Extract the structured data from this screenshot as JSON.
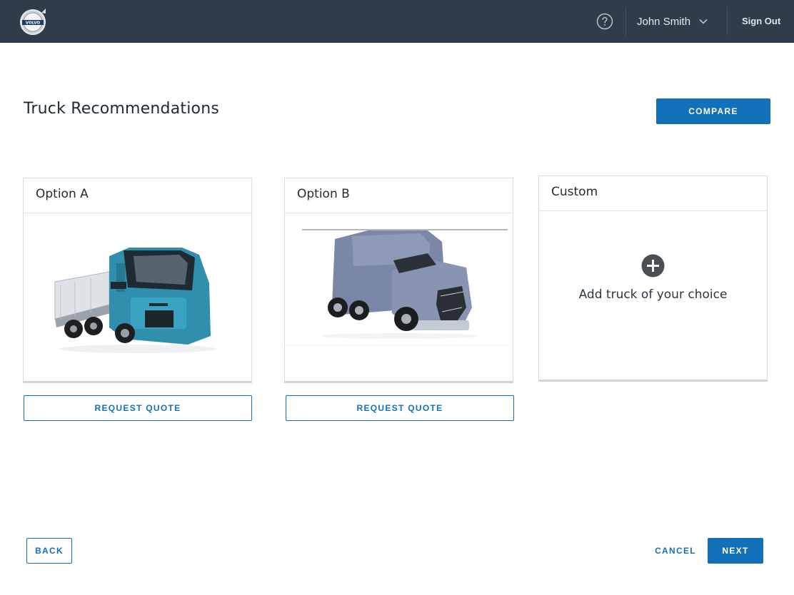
{
  "header": {
    "logo_text": "VOLVO",
    "user_name": "John Smith",
    "sign_out_label": "Sign Out",
    "help_icon": "help-circle-icon",
    "chevron_icon": "chevron-down-icon"
  },
  "page": {
    "title": "Truck Recommendations",
    "compare_label": "COMPARE"
  },
  "cards": [
    {
      "title": "Option A",
      "image": "blue-volvo-fe-flatbed-truck",
      "action_label": "REQUEST QUOTE"
    },
    {
      "title": "Option B",
      "image": "silver-volvo-vnl-semi-tractor",
      "action_label": "REQUEST QUOTE"
    },
    {
      "title": "Custom",
      "add_icon": "plus-circle-icon",
      "add_label": "Add truck of your choice"
    }
  ],
  "footer": {
    "back_label": "BACK",
    "cancel_label": "CANCEL",
    "next_label": "NEXT"
  },
  "colors": {
    "topbar": "#2f3d4b",
    "accent": "#1271b8"
  }
}
